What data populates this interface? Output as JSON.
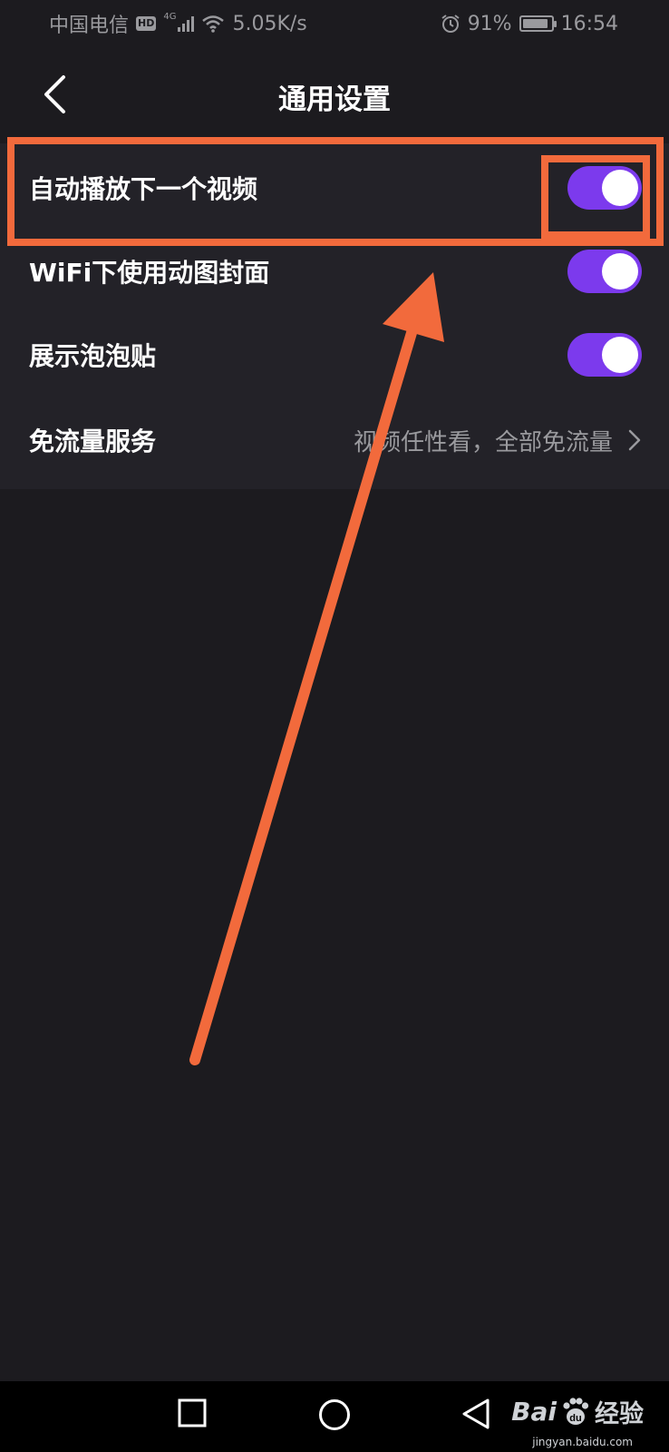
{
  "status_bar": {
    "carrier": "中国电信",
    "hd": "HD",
    "network_type": "4G",
    "net_speed": "5.05K/s",
    "battery_percent": "91%",
    "battery_level": 0.91,
    "time": "16:54"
  },
  "header": {
    "title": "通用设置",
    "back_icon": "chevron-left-icon"
  },
  "settings": {
    "autoplay_next": {
      "label": "自动播放下一个视频",
      "enabled": true
    },
    "wifi_dynamic_cover": {
      "label": "WiFi下使用动图封面",
      "enabled": true
    },
    "bubble_stickers": {
      "label": "展示泡泡贴",
      "enabled": true
    },
    "free_data_service": {
      "label": "免流量服务",
      "value": "视频任性看，全部免流量"
    }
  },
  "colors": {
    "accent": "#7c3aed",
    "annotation": "#f26a3c",
    "background": "#1c1b1f",
    "panel": "#232228"
  },
  "watermark": {
    "brand": "Bai",
    "paw": "du",
    "name": "经验",
    "url": "jingyan.baidu.com"
  }
}
